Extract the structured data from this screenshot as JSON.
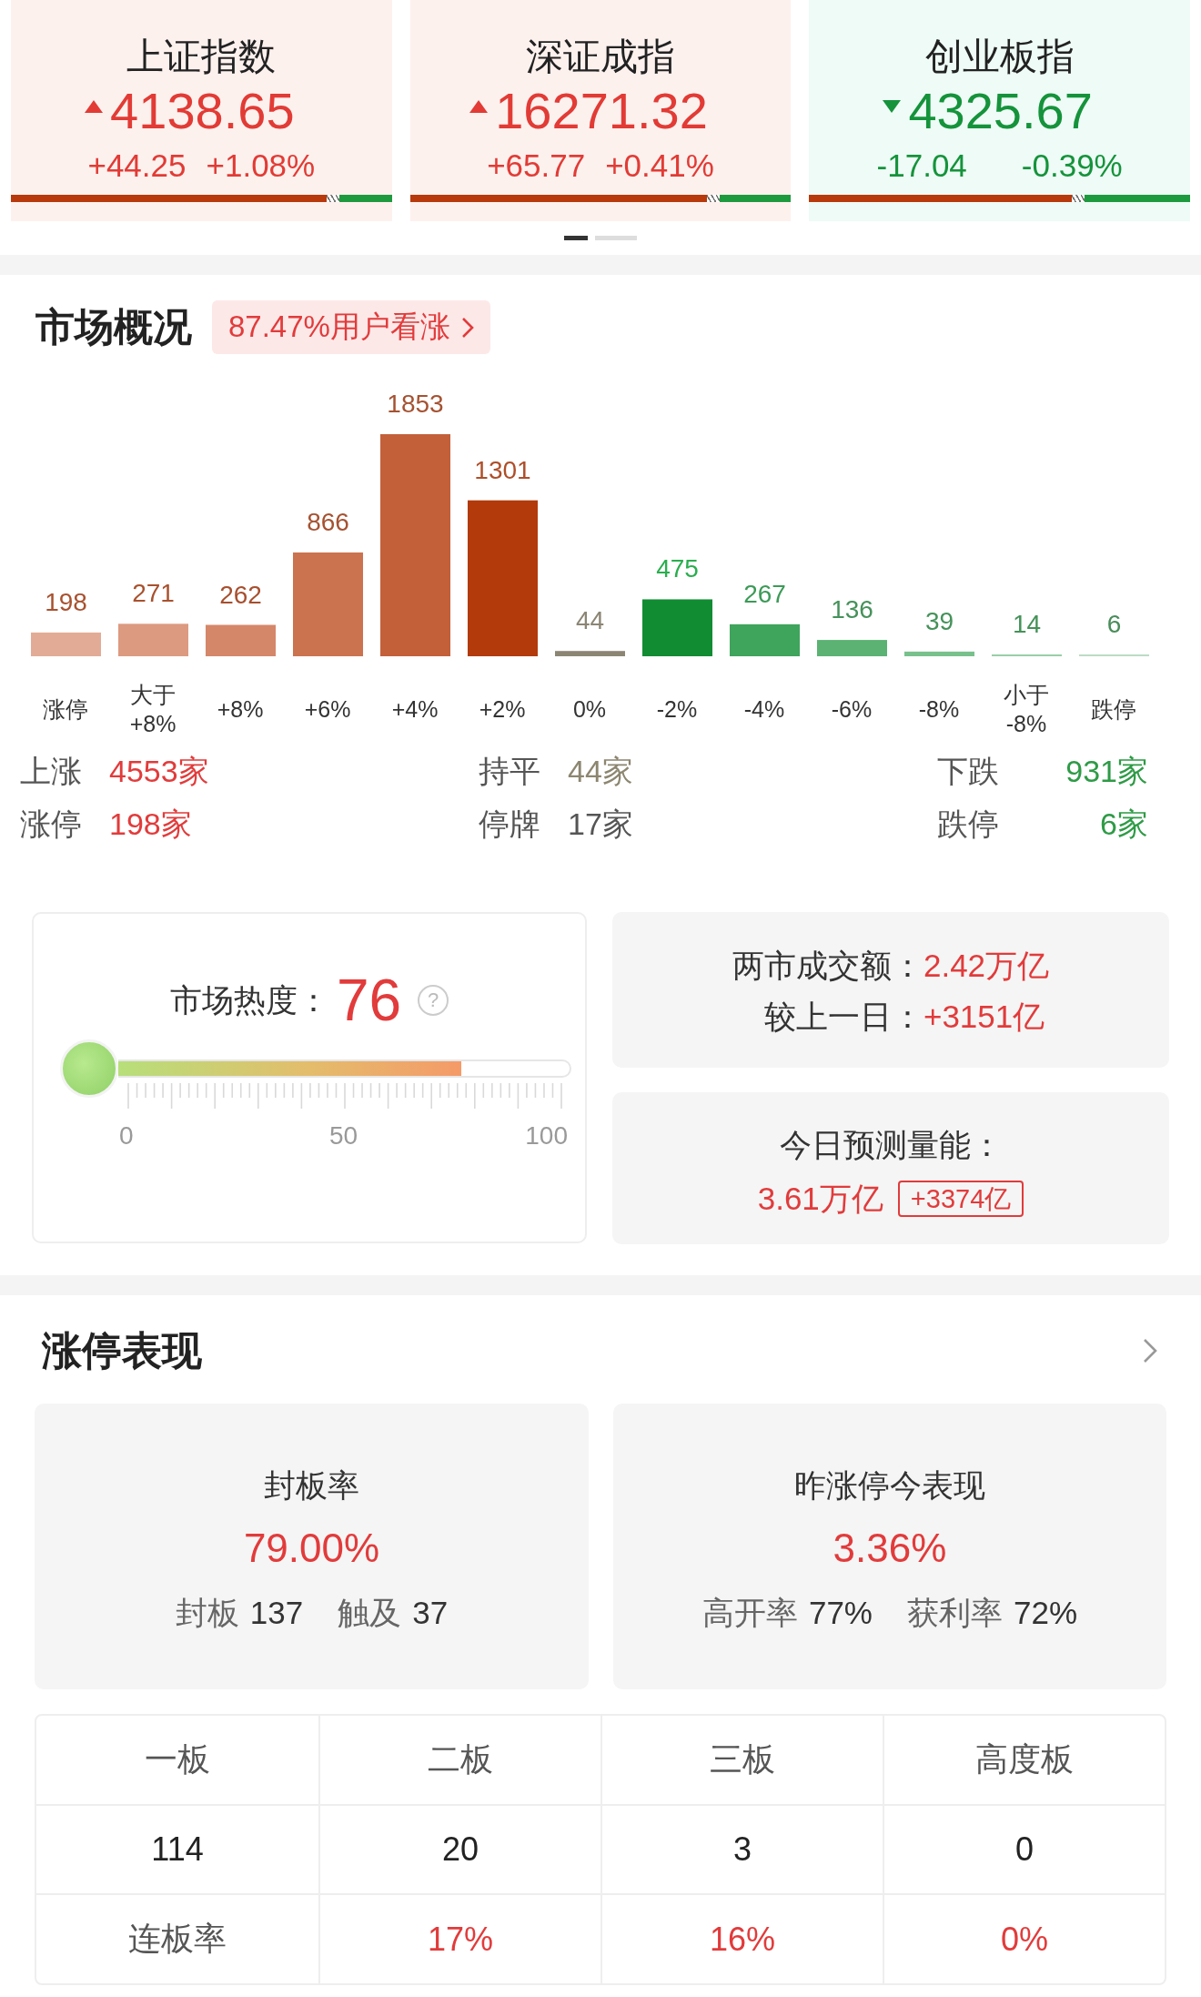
{
  "indices": [
    {
      "name": "上证指数",
      "value": "4138.65",
      "change": "+44.25",
      "percent": "+1.08%",
      "rising": true,
      "level": 0.83
    },
    {
      "name": "深证成指",
      "value": "16271.32",
      "change": "+65.77",
      "percent": "+0.41%",
      "rising": true,
      "level": 0.78
    },
    {
      "name": "创业板指",
      "value": "4325.67",
      "change": "-17.04",
      "percent": "-0.39%",
      "rising": false,
      "level": 0.69
    }
  ],
  "pager": [
    {
      "selected": true
    },
    {
      "selected": false
    }
  ],
  "market": {
    "title": "市场概况",
    "sentiment": "87.47%用户看涨",
    "chart_data": {
      "type": "bar",
      "categories": [
        "涨停",
        "大于 +8%",
        "+8%",
        "+6%",
        "+4%",
        "+2%",
        "0%",
        "-2%",
        "-4%",
        "-6%",
        "-8%",
        "小于 -8%",
        "跌停"
      ],
      "values": [
        198,
        271,
        262,
        866,
        1853,
        1301,
        44,
        475,
        267,
        136,
        39,
        14,
        6
      ],
      "colors": [
        "#e2ab95",
        "#dc9a80",
        "#d5876a",
        "#cb734f",
        "#c3603a",
        "#b23a0b",
        "#8b8574",
        "#118c33",
        "#3fa45c",
        "#5bb273",
        "#78c08c",
        "#99cfa7",
        "#bcdcc4"
      ],
      "data_labels": true
    },
    "stats": [
      {
        "label": "上涨",
        "value": "4553家",
        "color": "#e23b3b"
      },
      {
        "label": "持平",
        "value": "44家",
        "color": "#8c8670"
      },
      {
        "label": "下跌",
        "value": "931家",
        "color": "#2e9b46"
      },
      {
        "label": "涨停",
        "value": "198家",
        "color": "#e23b3b"
      },
      {
        "label": "停牌",
        "value": "17家",
        "color": "#555555"
      },
      {
        "label": "跌停",
        "value": "6家",
        "color": "#2e9b46"
      }
    ]
  },
  "heat": {
    "label": "市场热度：",
    "value": "76",
    "help": "?",
    "level": 0.76,
    "scale": [
      "0",
      "50",
      "100"
    ]
  },
  "turnover": {
    "rows": [
      {
        "label": "两市成交额：",
        "value": "2.42万亿"
      },
      {
        "label": "较上一日：",
        "value": "+3151亿"
      }
    ]
  },
  "forecast": {
    "label": "今日预测量能：",
    "value": "3.61万亿",
    "delta": "+3374亿"
  },
  "limit_up": {
    "title": "涨停表现",
    "cards": [
      {
        "title": "封板率",
        "value": "79.00%",
        "stats": [
          {
            "label": "封板",
            "value": "137"
          },
          {
            "label": "触及",
            "value": "37"
          }
        ]
      },
      {
        "title": "昨涨停今表现",
        "value": "3.36%",
        "stats": [
          {
            "label": "高开率",
            "value": "77%"
          },
          {
            "label": "获利率",
            "value": "72%"
          }
        ]
      }
    ],
    "table": {
      "columns": [
        "一板",
        "二板",
        "三板",
        "高度板"
      ],
      "rows": [
        {
          "kind": "count",
          "cells": [
            "114",
            "20",
            "3",
            "0"
          ]
        },
        {
          "kind": "rate",
          "cells": [
            "连板率",
            "17%",
            "16%",
            "0%"
          ]
        }
      ]
    }
  }
}
